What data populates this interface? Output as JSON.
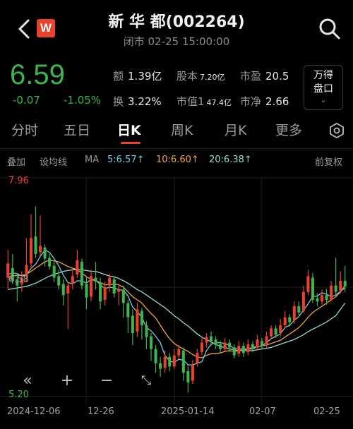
{
  "header": {
    "title": "新 华 都(002264)",
    "subtitle": "闭市 02-25 15:00:00",
    "logo_text": "W"
  },
  "quote": {
    "price": "6.59",
    "change": "-0.07",
    "change_pct": "-1.05%",
    "stats": [
      {
        "label": "额",
        "value": "1.39亿"
      },
      {
        "label": "股本",
        "value": "7.20亿"
      },
      {
        "label": "市盈",
        "value": "20.5"
      },
      {
        "label": "换",
        "value": "3.22%"
      },
      {
        "label": "市值1",
        "value": "47.4亿"
      },
      {
        "label": "市净",
        "value": "2.66"
      }
    ],
    "wande_line1": "万得",
    "wande_line2": "盘口"
  },
  "tabs": [
    "分时",
    "五日",
    "日K",
    "周K",
    "月K",
    "更多"
  ],
  "active_tab": "日K",
  "indicators": {
    "overlay": "叠加",
    "set_ma": "设均线",
    "ma_label": "MA",
    "ma5": "5:6.57↑",
    "ma10": "10:6.60↑",
    "ma20": "20:6.38↑",
    "adjust": "前复权"
  },
  "colors": {
    "up": "#e8412c",
    "down": "#3fb34f",
    "ma5": "#7ec8e3",
    "ma10": "#f0a34a",
    "ma20": "#9ad8c8"
  },
  "chart_data": {
    "type": "candlestick",
    "high_label": "7.96",
    "mid_label": "6.58",
    "low_label": "5.20",
    "x_labels": [
      "2024-12-06",
      "12-26",
      "2025-01-14",
      "02-07",
      "02-25"
    ],
    "ylim": [
      5.2,
      7.96
    ],
    "candles": [
      [
        6.7,
        6.88,
        7.05,
        6.56
      ],
      [
        6.82,
        6.66,
        7.0,
        6.62
      ],
      [
        6.68,
        6.6,
        6.76,
        6.4
      ],
      [
        6.62,
        6.7,
        6.78,
        6.52
      ],
      [
        6.72,
        6.86,
        7.2,
        6.64
      ],
      [
        6.88,
        7.2,
        7.5,
        6.8
      ],
      [
        7.22,
        7.0,
        7.6,
        6.95
      ],
      [
        7.02,
        7.1,
        7.48,
        6.98
      ],
      [
        7.08,
        6.94,
        7.12,
        6.84
      ],
      [
        6.95,
        6.84,
        7.0,
        6.8
      ],
      [
        6.85,
        6.7,
        6.9,
        6.64
      ],
      [
        6.72,
        6.6,
        6.8,
        6.55
      ],
      [
        6.62,
        6.48,
        6.68,
        6.35
      ],
      [
        6.5,
        6.6,
        6.65,
        6.05
      ],
      [
        6.62,
        6.72,
        6.82,
        6.55
      ],
      [
        6.74,
        6.92,
        7.05,
        6.7
      ],
      [
        6.9,
        6.6,
        6.94,
        6.55
      ],
      [
        6.62,
        6.45,
        6.7,
        6.3
      ],
      [
        6.46,
        6.72,
        6.8,
        6.4
      ],
      [
        6.7,
        6.65,
        6.9,
        6.55
      ],
      [
        6.64,
        6.4,
        6.7,
        6.3
      ],
      [
        6.42,
        6.58,
        6.65,
        6.35
      ],
      [
        6.6,
        6.7,
        6.75,
        6.52
      ],
      [
        6.68,
        6.5,
        6.72,
        6.45
      ],
      [
        6.52,
        6.55,
        6.6,
        6.35
      ],
      [
        6.55,
        6.38,
        6.6,
        6.2
      ],
      [
        6.38,
        6.2,
        6.42,
        6.0
      ],
      [
        6.22,
        6.0,
        6.3,
        5.85
      ],
      [
        6.02,
        6.3,
        6.38,
        5.95
      ],
      [
        6.28,
        6.1,
        6.32,
        5.92
      ],
      [
        6.1,
        5.95,
        6.15,
        5.8
      ],
      [
        5.96,
        5.8,
        6.0,
        5.65
      ],
      [
        5.8,
        5.62,
        5.85,
        5.5
      ],
      [
        5.62,
        5.55,
        5.7,
        5.45
      ],
      [
        5.56,
        5.7,
        5.78,
        5.5
      ],
      [
        5.7,
        5.58,
        5.75,
        5.52
      ],
      [
        5.58,
        5.72,
        5.8,
        5.55
      ],
      [
        5.72,
        5.8,
        5.85,
        5.68
      ],
      [
        5.78,
        5.5,
        5.82,
        5.4
      ],
      [
        5.52,
        5.38,
        5.58,
        5.25
      ],
      [
        5.4,
        5.6,
        5.66,
        5.36
      ],
      [
        5.62,
        5.75,
        5.8,
        5.58
      ],
      [
        5.76,
        5.88,
        5.95,
        5.72
      ],
      [
        5.88,
        5.95,
        6.0,
        5.82
      ],
      [
        5.96,
        5.9,
        6.02,
        5.84
      ],
      [
        5.92,
        5.85,
        5.96,
        5.8
      ],
      [
        5.86,
        5.8,
        5.9,
        5.74
      ],
      [
        5.8,
        5.88,
        5.94,
        5.76
      ],
      [
        5.88,
        5.82,
        5.92,
        5.76
      ],
      [
        5.82,
        5.72,
        5.86,
        5.68
      ],
      [
        5.74,
        5.84,
        5.9,
        5.7
      ],
      [
        5.84,
        5.75,
        5.88,
        5.7
      ],
      [
        5.76,
        5.86,
        5.92,
        5.72
      ],
      [
        5.86,
        5.8,
        5.9,
        5.76
      ],
      [
        5.82,
        5.92,
        5.98,
        5.78
      ],
      [
        5.9,
        5.84,
        5.94,
        5.8
      ],
      [
        5.86,
        5.96,
        6.02,
        5.82
      ],
      [
        5.96,
        6.06,
        6.1,
        5.92
      ],
      [
        6.06,
        5.98,
        6.1,
        5.94
      ],
      [
        6.0,
        6.1,
        6.18,
        5.96
      ],
      [
        6.1,
        6.2,
        6.28,
        6.06
      ],
      [
        6.2,
        6.14,
        6.24,
        6.08
      ],
      [
        6.16,
        6.34,
        6.4,
        6.12
      ],
      [
        6.34,
        6.26,
        6.4,
        6.2
      ],
      [
        6.28,
        6.52,
        6.6,
        6.26
      ],
      [
        6.52,
        6.72,
        6.8,
        6.48
      ],
      [
        6.7,
        6.42,
        6.76,
        6.38
      ],
      [
        6.44,
        6.4,
        6.5,
        6.34
      ],
      [
        6.4,
        6.48,
        6.55,
        6.36
      ],
      [
        6.48,
        6.42,
        6.56,
        6.36
      ],
      [
        6.42,
        6.6,
        6.66,
        6.4
      ],
      [
        6.6,
        6.52,
        6.95,
        6.48
      ],
      [
        6.54,
        6.66,
        6.78,
        6.5
      ],
      [
        6.66,
        6.59,
        6.85,
        6.52
      ]
    ],
    "ma5": [
      6.74,
      6.76,
      6.75,
      6.72,
      6.73,
      6.82,
      6.87,
      6.97,
      7.05,
      7.02,
      6.94,
      6.85,
      6.73,
      6.64,
      6.62,
      6.66,
      6.66,
      6.63,
      6.68,
      6.67,
      6.61,
      6.56,
      6.58,
      6.57,
      6.55,
      6.54,
      6.47,
      6.33,
      6.27,
      6.2,
      6.07,
      6.03,
      5.96,
      5.88,
      5.72,
      5.65,
      5.63,
      5.67,
      5.66,
      5.6,
      5.6,
      5.62,
      5.64,
      5.78,
      5.86,
      5.88,
      5.88,
      5.87,
      5.84,
      5.81,
      5.8,
      5.8,
      5.8,
      5.8,
      5.83,
      5.84,
      5.88,
      5.93,
      5.96,
      5.99,
      6.07,
      6.1,
      6.16,
      6.21,
      6.29,
      6.37,
      6.46,
      6.47,
      6.51,
      6.49,
      6.46,
      6.48,
      6.53,
      6.57
    ],
    "ma10": [
      6.7,
      6.72,
      6.73,
      6.73,
      6.74,
      6.78,
      6.82,
      6.86,
      6.9,
      6.92,
      6.91,
      6.9,
      6.87,
      6.84,
      6.82,
      6.8,
      6.76,
      6.71,
      6.68,
      6.66,
      6.64,
      6.61,
      6.61,
      6.62,
      6.61,
      6.58,
      6.52,
      6.46,
      6.42,
      6.38,
      6.31,
      6.25,
      6.19,
      6.1,
      6.01,
      5.93,
      5.87,
      5.83,
      5.8,
      5.77,
      5.73,
      5.7,
      5.69,
      5.72,
      5.74,
      5.74,
      5.75,
      5.77,
      5.78,
      5.77,
      5.78,
      5.79,
      5.8,
      5.82,
      5.83,
      5.84,
      5.85,
      5.87,
      5.89,
      5.91,
      5.95,
      5.99,
      6.03,
      6.07,
      6.13,
      6.2,
      6.26,
      6.3,
      6.34,
      6.38,
      6.42,
      6.46,
      6.52,
      6.6
    ],
    "ma20": [
      6.55,
      6.56,
      6.57,
      6.58,
      6.59,
      6.61,
      6.63,
      6.66,
      6.69,
      6.72,
      6.74,
      6.76,
      6.78,
      6.79,
      6.8,
      6.8,
      6.8,
      6.79,
      6.78,
      6.78,
      6.76,
      6.74,
      6.72,
      6.71,
      6.69,
      6.66,
      6.63,
      6.59,
      6.55,
      6.52,
      6.48,
      6.44,
      6.4,
      6.36,
      6.32,
      6.27,
      6.22,
      6.18,
      6.13,
      6.09,
      6.04,
      5.99,
      5.95,
      5.92,
      5.89,
      5.86,
      5.83,
      5.82,
      5.8,
      5.79,
      5.78,
      5.78,
      5.78,
      5.78,
      5.79,
      5.8,
      5.81,
      5.82,
      5.84,
      5.86,
      5.88,
      5.9,
      5.92,
      5.95,
      5.98,
      6.02,
      6.05,
      6.08,
      6.11,
      6.14,
      6.18,
      6.22,
      6.3,
      6.38
    ]
  },
  "controls": [
    "«",
    "+",
    "−",
    "⤡"
  ]
}
